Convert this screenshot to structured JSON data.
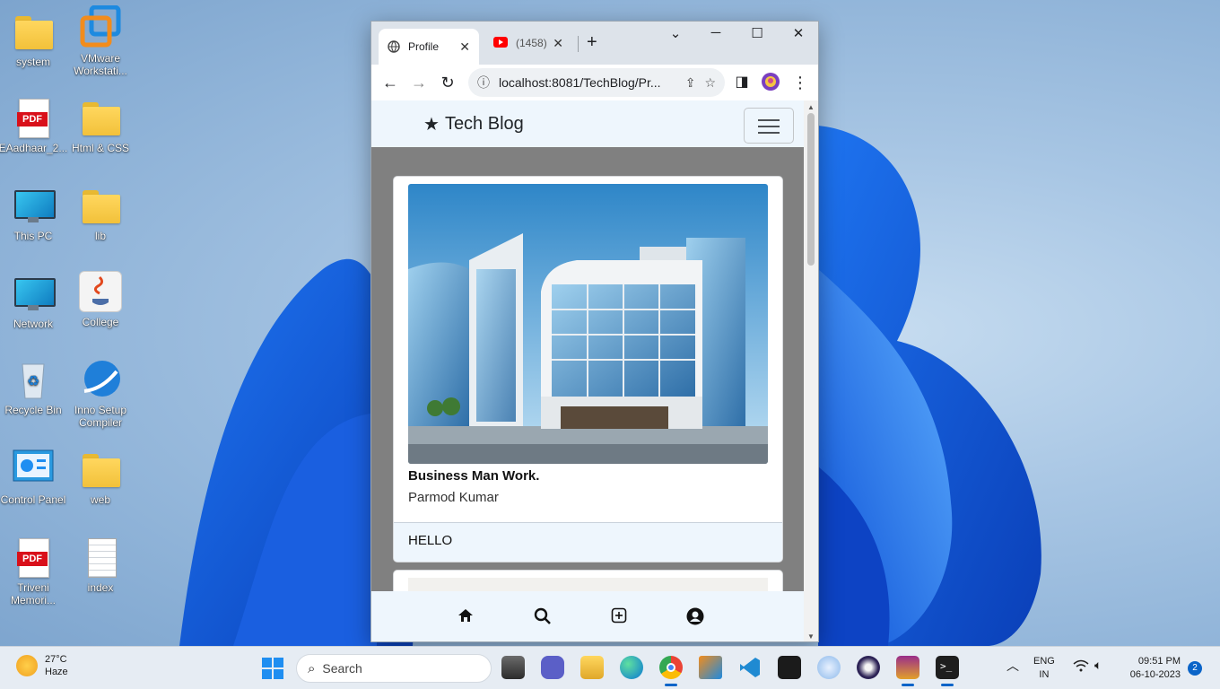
{
  "desktop": {
    "icons": [
      {
        "label": "system",
        "kind": "folder"
      },
      {
        "label": "VMware Workstati...",
        "kind": "app"
      },
      {
        "label": "EAadhaar_2...",
        "kind": "pdf"
      },
      {
        "label": "Html & CSS",
        "kind": "folder"
      },
      {
        "label": "This PC",
        "kind": "monitor"
      },
      {
        "label": "lib",
        "kind": "folder"
      },
      {
        "label": "Network",
        "kind": "monitor"
      },
      {
        "label": "College",
        "kind": "java"
      },
      {
        "label": "Recycle Bin",
        "kind": "recycle"
      },
      {
        "label": "Inno Setup Compiler",
        "kind": "app"
      },
      {
        "label": "Control Panel",
        "kind": "app"
      },
      {
        "label": "web",
        "kind": "folder"
      },
      {
        "label": "Triveni Memori...",
        "kind": "pdf"
      },
      {
        "label": "index",
        "kind": "document"
      }
    ],
    "pdf_badge": "PDF"
  },
  "browser": {
    "tabs": [
      {
        "label": "Profile",
        "icon": "globe-icon",
        "active": true
      },
      {
        "label": "(1458) Y",
        "icon": "youtube-icon",
        "active": false
      }
    ],
    "close_glyph": "✕",
    "new_tab_glyph": "+",
    "address": "localhost:8081/TechBlog/Pr...",
    "window_controls": {
      "dropdown": "⌄",
      "minimize": "─",
      "maximize": "☐",
      "close": "✕"
    }
  },
  "page": {
    "brand": "Tech Blog",
    "post": {
      "title": "Business Man Work.",
      "author": "Parmod Kumar",
      "footer": "HELLO"
    },
    "bottom_nav": [
      "home-icon",
      "search-icon",
      "add-post-icon",
      "profile-icon"
    ]
  },
  "taskbar": {
    "weather_temp": "27°C",
    "weather_desc": "Haze",
    "search_placeholder": "Search",
    "lang_top": "ENG",
    "lang_bottom": "IN",
    "time": "09:51 PM",
    "date": "06-10-2023",
    "notification_count": "2"
  }
}
